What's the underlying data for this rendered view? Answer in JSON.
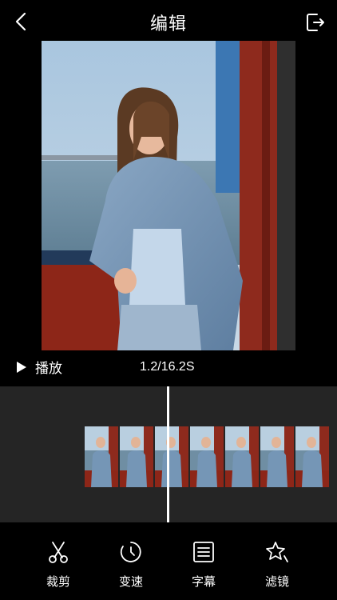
{
  "header": {
    "title": "编辑"
  },
  "playback": {
    "label": "播放",
    "time": "1.2/16.2S"
  },
  "toolbar": {
    "items": [
      {
        "label": "裁剪",
        "icon": "scissors-icon"
      },
      {
        "label": "变速",
        "icon": "speed-dial-icon"
      },
      {
        "label": "字幕",
        "icon": "subtitles-icon"
      },
      {
        "label": "滤镜",
        "icon": "sparkle-filter-icon"
      }
    ]
  },
  "colors": {
    "background": "#000000",
    "timeline": "#252525",
    "text": "#ffffff"
  }
}
